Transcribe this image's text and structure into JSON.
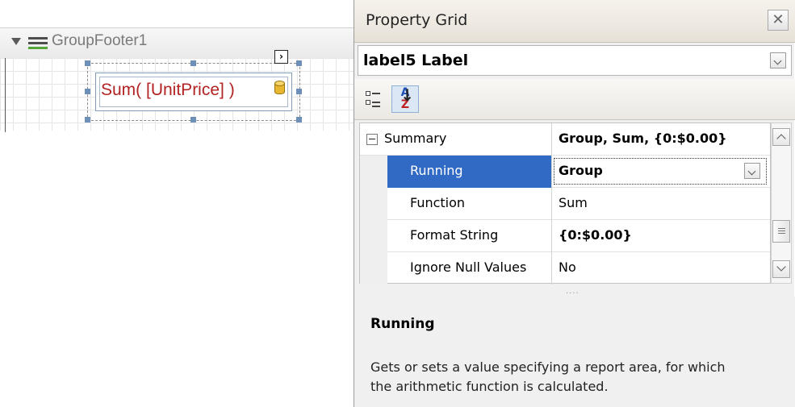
{
  "designer": {
    "band_title": "GroupFooter1",
    "label_expression": "Sum( [UnitPrice] )",
    "smart_tag_glyph": "›"
  },
  "property_grid": {
    "title": "Property Grid",
    "close_glyph": "✕",
    "selected_object": "label5  Label",
    "toolbar": {
      "categorized_icon": "categorized-view-icon",
      "alphabetical_icon": "sort-alphabetical-icon",
      "alphabetical_a": "A",
      "alphabetical_z": "Z",
      "alphabetical_arrow": "↓"
    },
    "rows": [
      {
        "name": "Summary",
        "value": "Group, Sum, {0:$0.00}"
      },
      {
        "name": "Running",
        "value": "Group"
      },
      {
        "name": "Function",
        "value": "Sum"
      },
      {
        "name": "Format String",
        "value": "{0:$0.00}"
      },
      {
        "name": "Ignore Null Values",
        "value": "No"
      }
    ],
    "splitter_dots": "....",
    "description": {
      "title": "Running",
      "text": "Gets or sets a value specifying a report area, for which the arithmetic function is calculated."
    }
  },
  "colors": {
    "selection": "#316ac5",
    "expression_text": "#b22222"
  }
}
